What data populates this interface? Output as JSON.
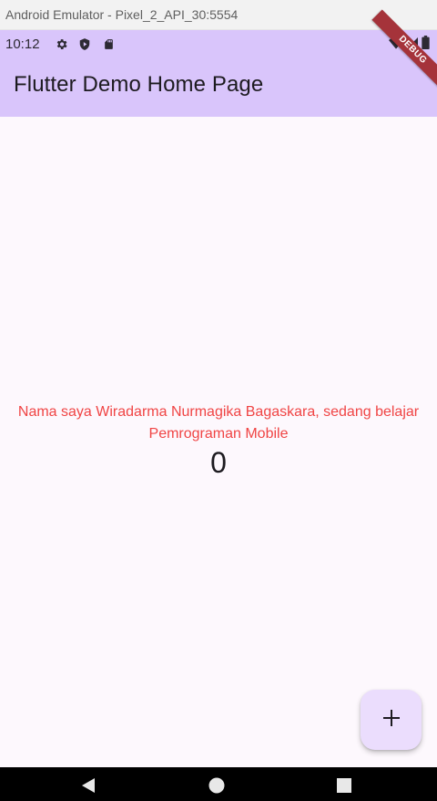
{
  "window": {
    "title": "Android Emulator - Pixel_2_API_30:5554"
  },
  "status_bar": {
    "time": "10:12",
    "left_icons": [
      "gear-icon",
      "shield-icon",
      "sd-card-icon"
    ],
    "right_icons": [
      "wifi-icon",
      "signal-icon",
      "battery-icon"
    ]
  },
  "app_bar": {
    "title": "Flutter Demo Home Page",
    "background": "#d9c5fb"
  },
  "debug_banner": {
    "label": "DEBUG",
    "color": "#a5333a"
  },
  "body": {
    "message": "Nama saya Wiradarma Nurmagika Bagaskara, sedang belajar Pemrograman Mobile",
    "message_color": "#f04444",
    "counter": "0"
  },
  "fab": {
    "icon": "plus-icon",
    "background": "#ebddfd"
  },
  "nav_bar": {
    "buttons": [
      "back-icon",
      "home-icon",
      "recents-icon"
    ]
  }
}
